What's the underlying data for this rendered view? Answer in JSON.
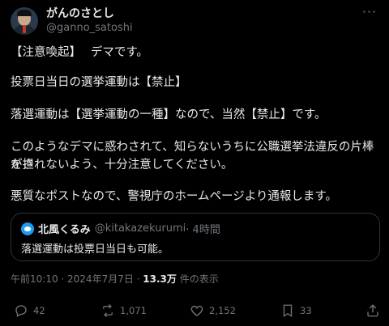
{
  "author": {
    "display_name": "がんのさとし",
    "handle": "@ganno_satoshi"
  },
  "body_lines": [
    "【注意喚起】　 デマです。",
    "投票日当日の選挙運動は【禁止】",
    "落選運動は【選挙運動の一種】なので、当然【禁止】です。",
    "このようなデマに惑わされて、知らないうちに公職選挙法違反の片棒を担",
    "がされないよう、十分注意してください。",
    "悪質なポストなので、警視庁のホームページより通報します。"
  ],
  "quote": {
    "name": "北風くるみ",
    "handle": "@kitakazekurumi",
    "time": " · 4時間",
    "text": "落選運動は投票日当日も可能。"
  },
  "meta": {
    "time": "午前10:10 · 2024年7月7日 · ",
    "views": "13.3万",
    "views_label": " 件の表示"
  },
  "actions": {
    "reply_count": "42",
    "retweet_count": "1,071",
    "like_count": "2,152",
    "bookmark_count": "33"
  },
  "more_label": "···"
}
